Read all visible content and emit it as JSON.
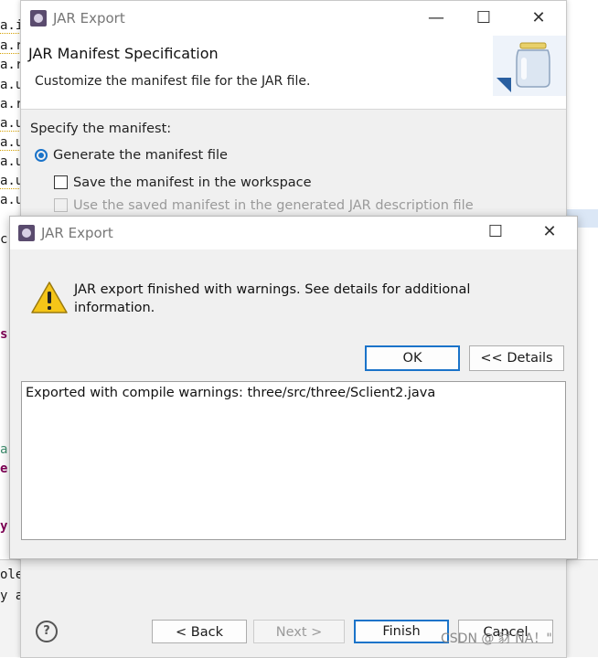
{
  "back_dialog": {
    "window_title": "JAR Export",
    "header_title": "JAR Manifest Specification",
    "header_description": "Customize the manifest file for the JAR file.",
    "section_label": "Specify the manifest:",
    "option_generate": "Generate the manifest file",
    "option_save": "Save the manifest in the workspace",
    "option_use_saved": "Use the saved manifest in the generated JAR description file",
    "buttons": {
      "help": "?",
      "back": "< Back",
      "next": "Next >",
      "finish": "Finish",
      "cancel": "Cancel"
    }
  },
  "front_dialog": {
    "window_title": "JAR Export",
    "message": "JAR export finished with warnings. See details for additional information.",
    "ok_label": "OK",
    "details_label": "<< Details",
    "details_text": "Exported with compile warnings: three/src/three/Sclient2.java"
  },
  "editor": {
    "left_fragments": [
      "a.i",
      "a.r",
      "a.r",
      "a.u",
      "a.r",
      "a.u",
      "a.u",
      "a.u",
      "a.u",
      "a.u"
    ],
    "fragment_c": "c",
    "fragment_s": "s",
    "fragment_a": "a",
    "fragment_e": "e",
    "fragment_y": "y",
    "bottom_line1": "ole",
    "bottom_line2": "y a"
  },
  "watermark": "CSDN @ 豺 NA！\""
}
